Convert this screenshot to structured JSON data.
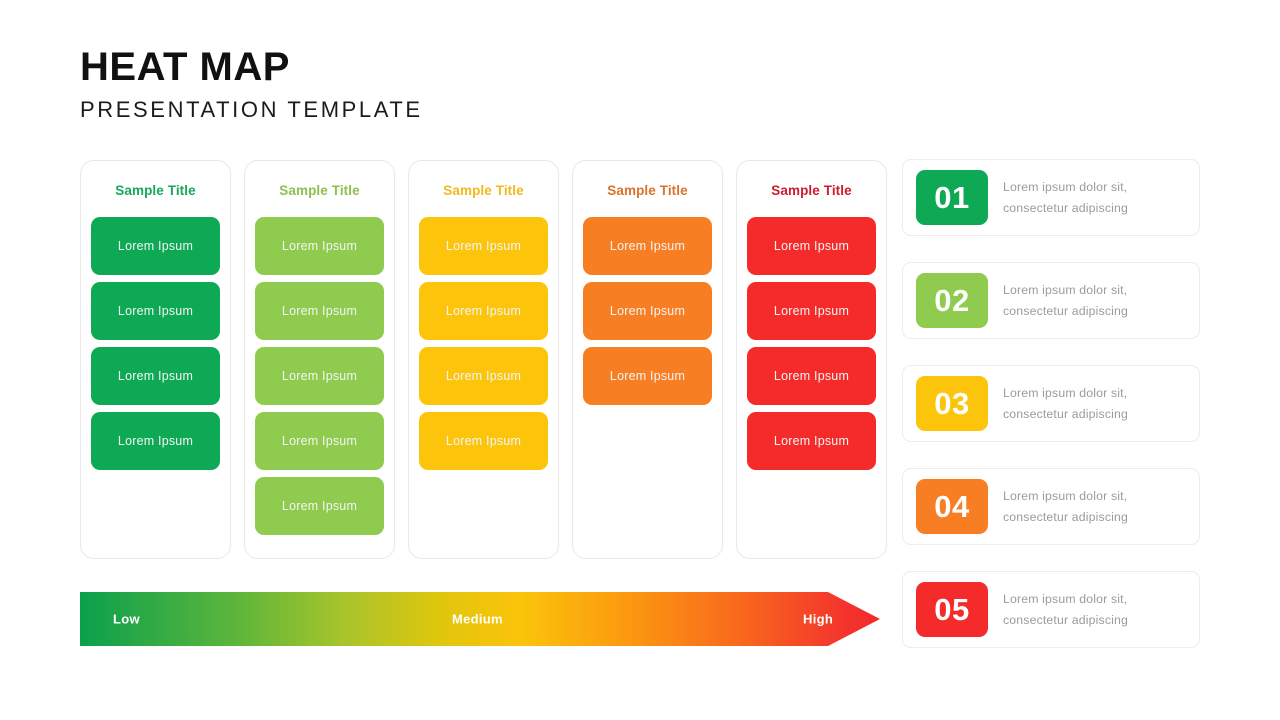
{
  "header": {
    "title": "HEAT MAP",
    "subtitle": "PRESENTATION TEMPLATE"
  },
  "palette": {
    "green_dark": "#0DA955",
    "green_light": "#8FCB4E",
    "yellow": "#FCC40B",
    "orange": "#F87E23",
    "red": "#F52A2A",
    "title_green_dark": "#16A75C",
    "title_green_light": "#8FBF4E",
    "title_yellow": "#F2B81C",
    "title_orange": "#D9722C",
    "title_red": "#CE1A2E"
  },
  "columns": [
    {
      "title": "Sample Title",
      "title_color": "#16A75C",
      "cell_color": "#0DA955",
      "glow": "#7fe3b4",
      "cells": [
        "Lorem Ipsum",
        "Lorem Ipsum",
        "Lorem Ipsum",
        "Lorem Ipsum"
      ]
    },
    {
      "title": "Sample Title",
      "title_color": "#8FBF4E",
      "cell_color": "#8FCB4E",
      "glow": "#cbe6a0",
      "cells": [
        "Lorem Ipsum",
        "Lorem Ipsum",
        "Lorem Ipsum",
        "Lorem Ipsum",
        "Lorem Ipsum"
      ]
    },
    {
      "title": "Sample Title",
      "title_color": "#F2B81C",
      "cell_color": "#FCC40B",
      "glow": "#fbe29b",
      "cells": [
        "Lorem Ipsum",
        "Lorem Ipsum",
        "Lorem Ipsum",
        "Lorem Ipsum"
      ]
    },
    {
      "title": "Sample Title",
      "title_color": "#D9722C",
      "cell_color": "#F87E23",
      "glow": "#fbc3a0",
      "cells": [
        "Lorem Ipsum",
        "Lorem Ipsum",
        "Lorem Ipsum"
      ]
    },
    {
      "title": "Sample Title",
      "title_color": "#CE1A2E",
      "cell_color": "#F52A2A",
      "glow": "#fba8ad",
      "cells": [
        "Lorem Ipsum",
        "Lorem Ipsum",
        "Lorem Ipsum",
        "Lorem Ipsum"
      ]
    }
  ],
  "legend": {
    "low": "Low",
    "medium": "Medium",
    "high": "High",
    "gradient_stops": [
      "#0BA04D",
      "#A8C42B",
      "#FBC40A",
      "#F86A1C",
      "#F22A2A"
    ]
  },
  "list": [
    {
      "number": "01",
      "color": "#0DA955",
      "text": "Lorem ipsum dolor sit, consectetur adipiscing"
    },
    {
      "number": "02",
      "color": "#8FCB4E",
      "text": "Lorem ipsum dolor sit, consectetur adipiscing"
    },
    {
      "number": "03",
      "color": "#FCC40B",
      "text": "Lorem ipsum dolor sit, consectetur adipiscing"
    },
    {
      "number": "04",
      "color": "#F87E23",
      "text": "Lorem ipsum dolor sit, consectetur adipiscing"
    },
    {
      "number": "05",
      "color": "#F52A2A",
      "text": "Lorem ipsum dolor sit, consectetur adipiscing"
    }
  ]
}
